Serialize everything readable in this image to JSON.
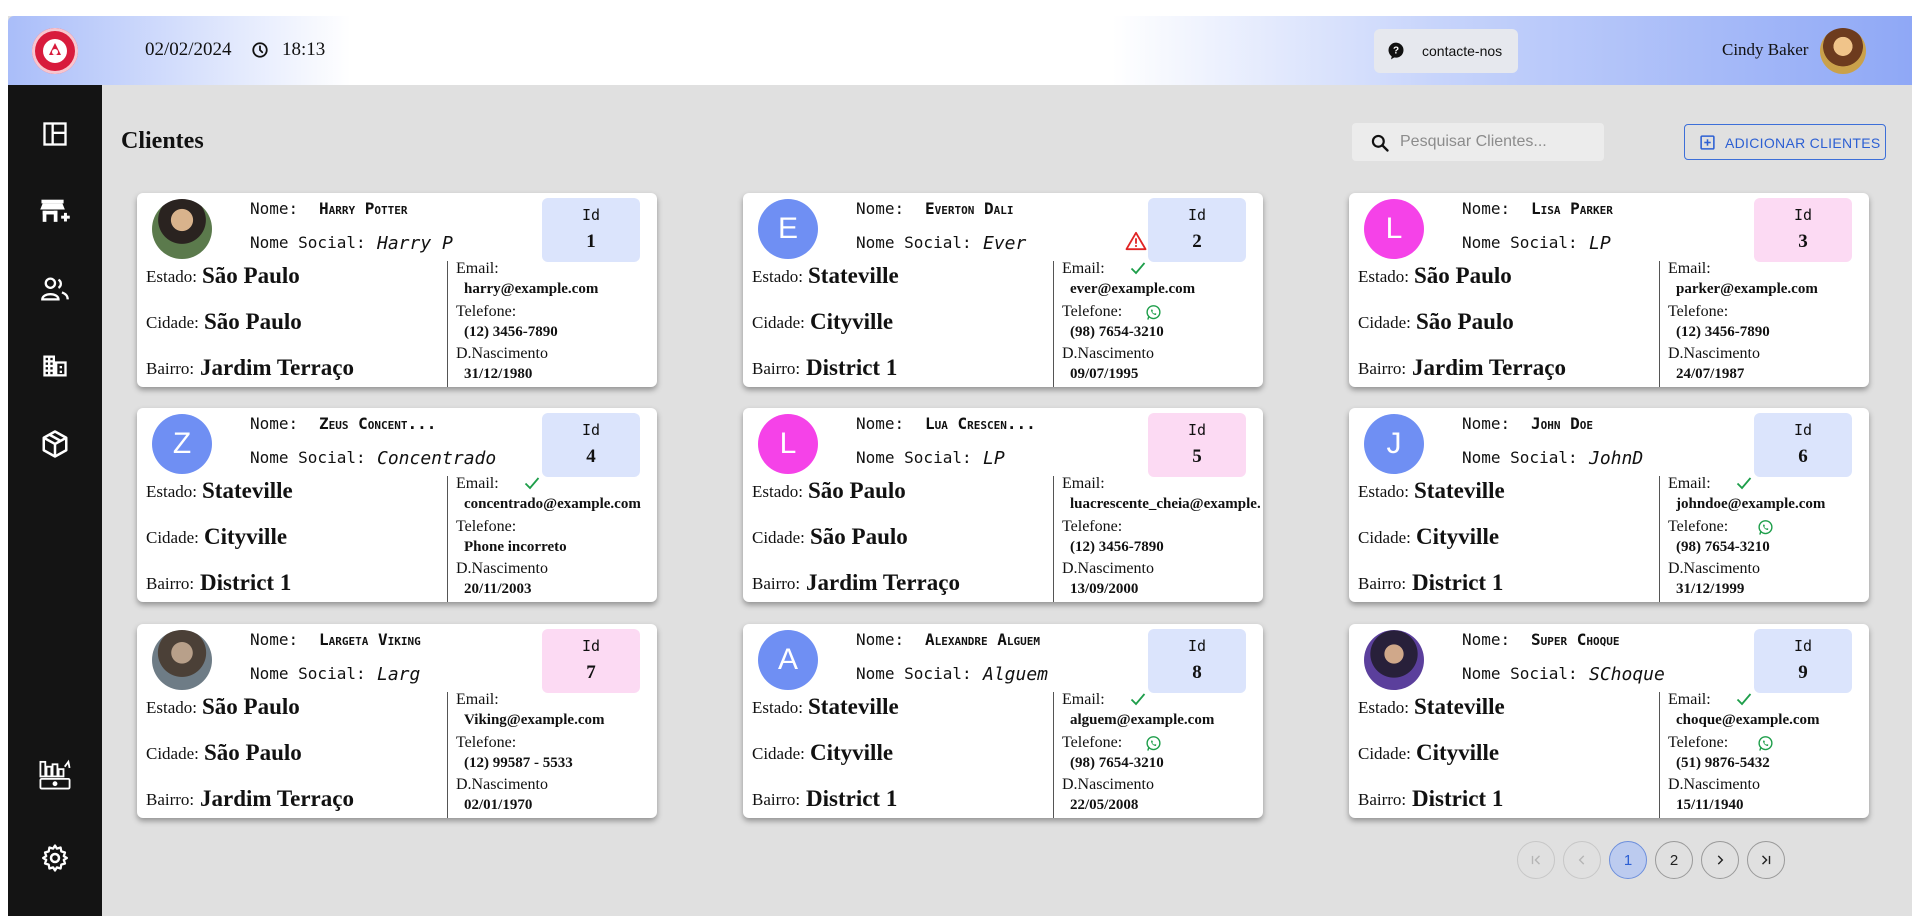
{
  "header": {
    "date": "02/02/2024",
    "time": "18:13",
    "contact_label": "contacte-nos",
    "user_name": "Cindy Baker"
  },
  "sidebar": {
    "items": [
      "dashboard-icon",
      "add-store-icon",
      "users-icon",
      "buildings-icon",
      "package-icon",
      "billing-icon",
      "settings-icon"
    ]
  },
  "main": {
    "title": "Clientes",
    "search_placeholder": "Pesquisar Clientes...",
    "add_button": "ADICIONAR CLIENTES"
  },
  "labels": {
    "nome": "Nome:",
    "nome_social": "Nome Social:",
    "id": "Id",
    "estado": "Estado:",
    "cidade": "Cidade:",
    "bairro": "Bairro:",
    "email": "Email:",
    "telefone": "Telefone:",
    "nascimento": "D.Nascimento"
  },
  "clients": [
    {
      "id": "1",
      "avatar": "",
      "avatar_color": "",
      "photo": "harry",
      "id_color": "blue",
      "nome": "Harry Potter",
      "nome_social": "Harry P",
      "estado": "São Paulo",
      "cidade": "São Paulo",
      "bairro": "Jardim Terraço",
      "email": "harry@example.com",
      "telefone": "(12) 3456-7890",
      "nascimento": "31/12/1980",
      "email_ok": false,
      "whatsapp": false,
      "warning": false
    },
    {
      "id": "2",
      "avatar": "E",
      "avatar_color": "#6f8ff3",
      "photo": "",
      "id_color": "blue",
      "nome": "Everton Dali",
      "nome_social": "Ever",
      "estado": "Stateville",
      "cidade": "Cityville",
      "bairro": "District 1",
      "email": "ever@example.com",
      "telefone": "(98) 7654-3210",
      "nascimento": "09/07/1995",
      "email_ok": true,
      "whatsapp": true,
      "warning": true
    },
    {
      "id": "3",
      "avatar": "L",
      "avatar_color": "#f542e8",
      "photo": "",
      "id_color": "pink",
      "nome": "Lisa Parker",
      "nome_social": "LP",
      "estado": "São Paulo",
      "cidade": "São Paulo",
      "bairro": "Jardim Terraço",
      "email": "parker@example.com",
      "telefone": "(12) 3456-7890",
      "nascimento": "24/07/1987",
      "email_ok": false,
      "whatsapp": false,
      "warning": false
    },
    {
      "id": "4",
      "avatar": "Z",
      "avatar_color": "#6f8ff3",
      "photo": "",
      "id_color": "blue",
      "nome": "Zeus Concent...",
      "nome_social": "Concentrado",
      "estado": "Stateville",
      "cidade": "Cityville",
      "bairro": "District 1",
      "email": "concentrado@example.com",
      "telefone": "Phone incorreto",
      "nascimento": "20/11/2003",
      "email_ok": true,
      "whatsapp": false,
      "warning": false
    },
    {
      "id": "5",
      "avatar": "L",
      "avatar_color": "#f542e8",
      "photo": "",
      "id_color": "pink",
      "nome": "Lua Crescen...",
      "nome_social": "LP",
      "estado": "São Paulo",
      "cidade": "São Paulo",
      "bairro": "Jardim Terraço",
      "email": "luacrescente_cheia@example.com",
      "telefone": "(12) 3456-7890",
      "nascimento": "13/09/2000",
      "email_ok": false,
      "whatsapp": false,
      "warning": false
    },
    {
      "id": "6",
      "avatar": "J",
      "avatar_color": "#6f8ff3",
      "photo": "",
      "id_color": "blue",
      "nome": "John Doe",
      "nome_social": "JohnD",
      "estado": "Stateville",
      "cidade": "Cityville",
      "bairro": "District 1",
      "email": "johndoe@example.com",
      "telefone": "(98) 7654-3210",
      "nascimento": "31/12/1999",
      "email_ok": true,
      "whatsapp": true,
      "warning": false
    },
    {
      "id": "7",
      "avatar": "",
      "avatar_color": "",
      "photo": "viking",
      "id_color": "pink",
      "nome": "Largeta Viking",
      "nome_social": "Larg",
      "estado": "São Paulo",
      "cidade": "São Paulo",
      "bairro": "Jardim Terraço",
      "email": "Viking@example.com",
      "telefone": "(12) 99587 - 5533",
      "nascimento": "02/01/1970",
      "email_ok": false,
      "whatsapp": false,
      "warning": false
    },
    {
      "id": "8",
      "avatar": "A",
      "avatar_color": "#6f8ff3",
      "photo": "",
      "id_color": "blue",
      "nome": "Alexandre Alguem",
      "nome_social": "Alguem",
      "estado": "Stateville",
      "cidade": "Cityville",
      "bairro": "District 1",
      "email": "alguem@example.com",
      "telefone": "(98) 7654-3210",
      "nascimento": "22/05/2008",
      "email_ok": true,
      "whatsapp": true,
      "warning": false
    },
    {
      "id": "9",
      "avatar": "",
      "avatar_color": "",
      "photo": "choque",
      "id_color": "blue",
      "nome": "Super Choque",
      "nome_social": "SChoque",
      "estado": "Stateville",
      "cidade": "Cityville",
      "bairro": "District 1",
      "email": "choque@example.com",
      "telefone": "(51) 9876-5432",
      "nascimento": "15/11/1940",
      "email_ok": true,
      "whatsapp": true,
      "warning": false
    }
  ],
  "pagination": {
    "pages": [
      "1",
      "2"
    ],
    "current": "1"
  },
  "colors": {
    "accent": "#2c5fd3",
    "avatar_blue": "#6f8ff3",
    "avatar_pink": "#f542e8",
    "whatsapp": "#1e9e4a",
    "warning": "#e02424"
  }
}
